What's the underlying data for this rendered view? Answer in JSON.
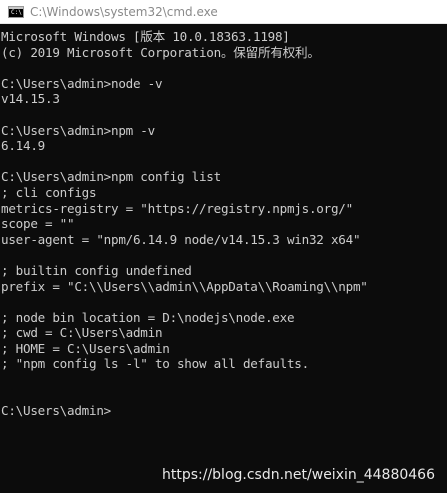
{
  "window": {
    "title": "C:\\Windows\\system32\\cmd.exe",
    "icon_name": "cmd-window-icon",
    "icon_glyph": "C:\\",
    "background_color": "#0c0c0c",
    "text_color": "#cccccc"
  },
  "console": {
    "lines": [
      "Microsoft Windows [版本 10.0.18363.1198]",
      "(c) 2019 Microsoft Corporation。保留所有权利。",
      "",
      "C:\\Users\\admin>node -v",
      "v14.15.3",
      "",
      "C:\\Users\\admin>npm -v",
      "6.14.9",
      "",
      "C:\\Users\\admin>npm config list",
      "; cli configs",
      "metrics-registry = \"https://registry.npmjs.org/\"",
      "scope = \"\"",
      "user-agent = \"npm/6.14.9 node/v14.15.3 win32 x64\"",
      "",
      "; builtin config undefined",
      "prefix = \"C:\\\\Users\\\\admin\\\\AppData\\\\Roaming\\\\npm\"",
      "",
      "; node bin location = D:\\nodejs\\node.exe",
      "; cwd = C:\\Users\\admin",
      "; HOME = C:\\Users\\admin",
      "; \"npm config ls -l\" to show all defaults.",
      "",
      "",
      "C:\\Users\\admin>"
    ]
  },
  "watermark": {
    "text": "https://blog.csdn.net/weixin_44880466"
  }
}
